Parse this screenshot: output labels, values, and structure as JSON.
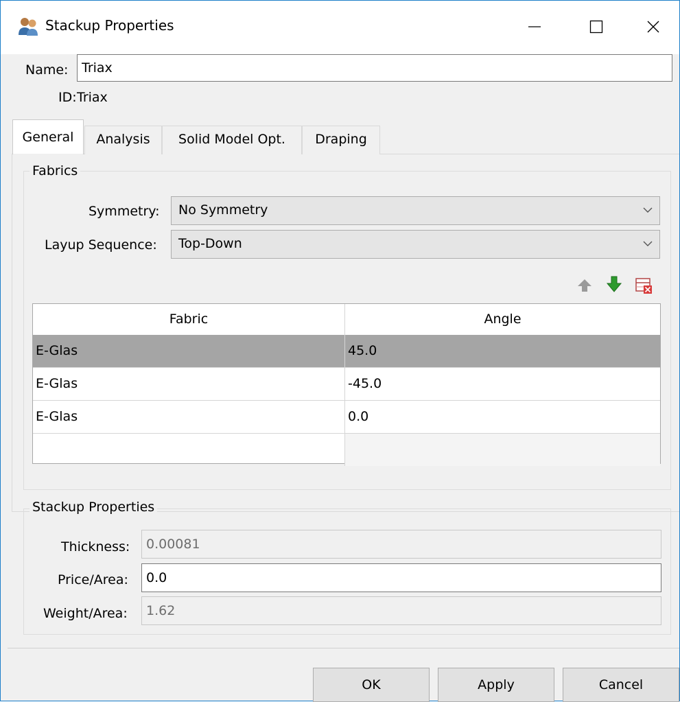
{
  "window": {
    "title": "Stackup Properties",
    "icon": "users-icon"
  },
  "name": {
    "label": "Name:",
    "value": "Triax"
  },
  "id": {
    "label": "ID:",
    "value": "Triax"
  },
  "tabs": [
    {
      "label": "General",
      "active": true
    },
    {
      "label": "Analysis",
      "active": false
    },
    {
      "label": "Solid Model Opt.",
      "active": false
    },
    {
      "label": "Draping",
      "active": false
    }
  ],
  "fabrics": {
    "title": "Fabrics",
    "symmetry": {
      "label": "Symmetry:",
      "value": "No Symmetry"
    },
    "layup": {
      "label": "Layup Sequence:",
      "value": "Top-Down"
    },
    "toolbar": [
      "move-up-icon",
      "move-down-icon",
      "delete-row-icon"
    ],
    "table": {
      "columns": [
        "Fabric",
        "Angle"
      ],
      "rows": [
        {
          "fabric": "E-Glas",
          "angle": "45.0",
          "selected": true
        },
        {
          "fabric": "E-Glas",
          "angle": "-45.0",
          "selected": false
        },
        {
          "fabric": "E-Glas",
          "angle": "0.0",
          "selected": false
        },
        {
          "fabric": "",
          "angle": "",
          "selected": false
        }
      ]
    }
  },
  "stackup": {
    "title": "Stackup Properties",
    "thickness": {
      "label": "Thickness:",
      "value": "0.00081"
    },
    "price": {
      "label": "Price/Area:",
      "value": "0.0"
    },
    "weight": {
      "label": "Weight/Area:",
      "value": "1.62"
    }
  },
  "buttons": {
    "ok": "OK",
    "apply": "Apply",
    "cancel": "Cancel"
  },
  "colors": {
    "accent": "#1c7ec9",
    "selected_row": "#a5a5a5",
    "down_arrow": "#2e9a2e"
  }
}
